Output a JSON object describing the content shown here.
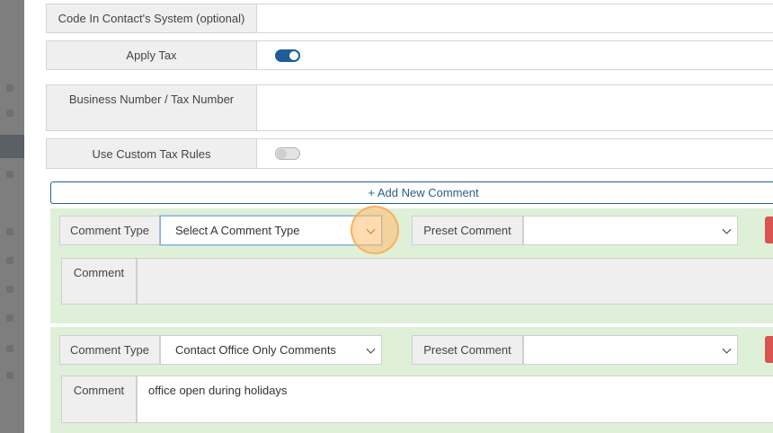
{
  "form": {
    "code_label": "Code In Contact's System (optional)",
    "code_value": "",
    "apply_tax_label": "Apply Tax",
    "apply_tax_on": true,
    "business_number_label": "Business Number / Tax Number",
    "business_number_value": "",
    "custom_tax_label": "Use Custom Tax Rules",
    "custom_tax_on": false
  },
  "comments": {
    "add_button_label": "+ Add New Comment",
    "items": [
      {
        "type_label": "Comment Type",
        "type_value": "Select A Comment Type",
        "preset_label": "Preset Comment",
        "preset_value": "",
        "comment_label": "Comment",
        "comment_value": ""
      },
      {
        "type_label": "Comment Type",
        "type_value": "Contact Office Only Comments",
        "preset_label": "Preset Comment",
        "preset_value": "",
        "comment_label": "Comment",
        "comment_value": "office open during holidays"
      }
    ]
  },
  "colors": {
    "toggle_on": "#1f5e96",
    "comment_bg": "#dff0d8",
    "delete_red": "#d9534f",
    "add_button_border": "#2a5f8c",
    "click_highlight": "#f9b36a"
  }
}
